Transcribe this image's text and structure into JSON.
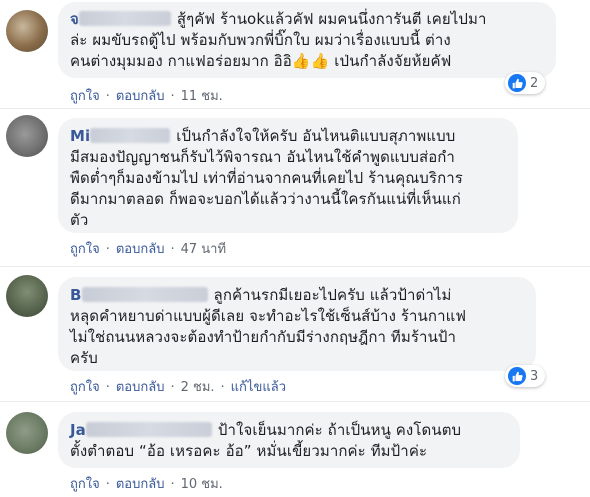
{
  "comments": [
    {
      "name_visible": "จ",
      "text_line1": "สู้ๆคัฟ ร้านokแล้วคัฟ ผมคนนึ่งการันตี เคยไปมา",
      "text_rest": "ล่ะ ผมขับรถตู้ไป พร้อมกับพวกพี่บิ๊กใบ ผมว่าเรื่องแบบนี้ ต่าง\nคนต่างมุมมอง กาแฟอร่อยมาก อิอิ👍👍 เป่นกำลังจัยห้ยคัฟ",
      "like": "ถูกใจ",
      "reply": "ตอบกลับ",
      "time": "11 ชม.",
      "reactions": "2"
    },
    {
      "name_visible": "Mi",
      "text_line1": "เป็นกำลังใจให้ครับ อันไหนติแบบสุภาพแบบ",
      "text_rest": "มีสมองปัญญาชนก็รับไว้พิจารณา อันไหนใช้คำพูดแบบส่อกำ\nพืดต่ำๆก็มองข้ามไป เท่าที่อ่านจากคนที่เคยไป ร้านคุณบริการ\nดีมากมาตลอด ก็พอจะบอกได้แล้วว่างานนี้ใครกันแน่ที่เห็นแก่\nตัว",
      "like": "ถูกใจ",
      "reply": "ตอบกลับ",
      "time": "47 นาที"
    },
    {
      "name_visible": "B",
      "text_line1": "ลูกค้านรกมีเยอะไปครับ แล้วป้าด่าไม่",
      "text_rest": "หลุดคำหยาบด่าแบบผู้ดีเลย จะทำอะไรใช้เซ็นส์บ้าง ร้านกาแฟ\nไม่ใช่ถนนหลวงจะต้องทำป้ายกำกับมีร่างกฤษฎีกา ทีมร้านป้า\nครับ",
      "like": "ถูกใจ",
      "reply": "ตอบกลับ",
      "time": "2 ชม.",
      "edited": "แก้ไขแล้ว",
      "reactions": "3"
    },
    {
      "name_visible": "Ja",
      "text_line1": "ป้าใจเย็นมากค่ะ ถ้าเป็นหนู คงโดนตบ",
      "text_rest": "ตั้งตำตอบ “อ้อ เหรอคะ อ้อ” หมั่นเขี้ยวมากค่ะ ทีมป้าค่ะ",
      "like": "ถูกใจ",
      "reply": "ตอบกลับ",
      "time": "10 ชม."
    }
  ],
  "colors": {
    "link": "#385898",
    "meta": "#606770",
    "bubble": "#f2f3f5",
    "like_blue": "#1877f2"
  },
  "icons": [
    "like-icon",
    "avatar"
  ]
}
